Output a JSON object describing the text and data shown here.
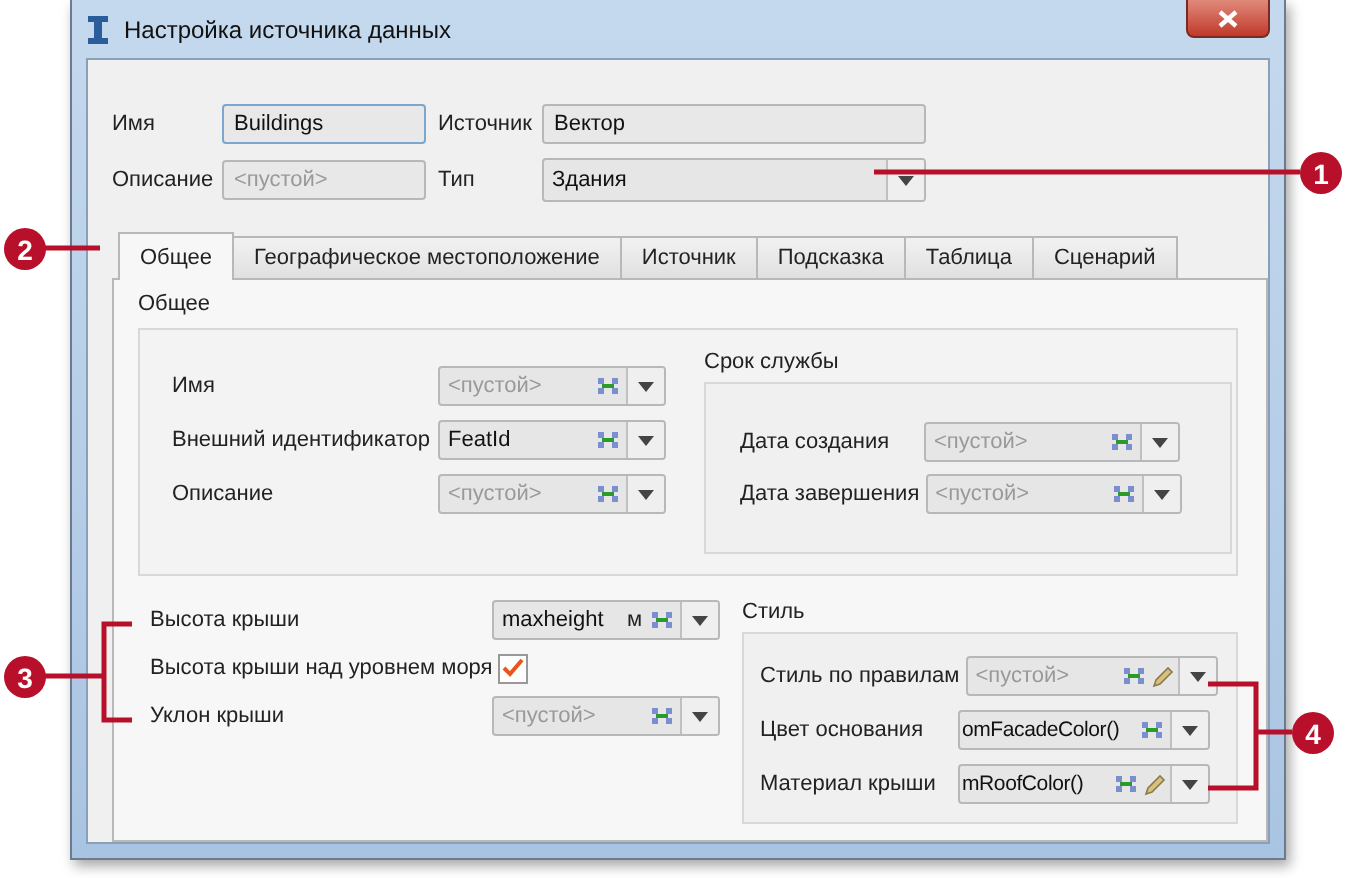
{
  "window": {
    "title": "Настройка источника данных"
  },
  "header": {
    "name": {
      "label": "Имя",
      "value": "Buildings"
    },
    "source": {
      "label": "Источник",
      "value": "Вектор"
    },
    "description": {
      "label": "Описание",
      "placeholder": "<пустой>"
    },
    "type": {
      "label": "Тип",
      "value": "Здания"
    }
  },
  "tabs": [
    {
      "label": "Общее",
      "selected": true
    },
    {
      "label": "Географическое местоположение",
      "selected": false
    },
    {
      "label": "Источник",
      "selected": false
    },
    {
      "label": "Подсказка",
      "selected": false
    },
    {
      "label": "Таблица",
      "selected": false
    },
    {
      "label": "Сценарий",
      "selected": false
    }
  ],
  "general": {
    "title": "Общее",
    "fields": [
      {
        "label": "Имя",
        "placeholder": "<пустой>"
      },
      {
        "label": "Внешний идентификатор",
        "value": "FeatId"
      },
      {
        "label": "Описание",
        "placeholder": "<пустой>"
      }
    ],
    "service_life": {
      "title": "Срок службы",
      "fields": [
        {
          "label": "Дата создания",
          "placeholder": "<пустой>"
        },
        {
          "label": "Дата завершения",
          "placeholder": "<пустой>"
        }
      ]
    }
  },
  "roof": [
    {
      "kind": "combo",
      "label": "Высота крыши",
      "value": "maxheight",
      "unit": "м"
    },
    {
      "kind": "checkbox",
      "label": "Высота крыши над уровнем моря",
      "checked": true
    },
    {
      "kind": "combo",
      "label": "Уклон крыши",
      "placeholder": "<пустой>"
    }
  ],
  "style": {
    "title": "Стиль",
    "fields": [
      {
        "label": "Стиль по правилам",
        "placeholder": "<пустой>",
        "editable": true
      },
      {
        "label": "Цвет основания",
        "value": "omFacadeColor()",
        "editable": false
      },
      {
        "label": "Материал крыши",
        "value": "mRoofColor()",
        "editable": true
      }
    ]
  },
  "callouts": [
    "1",
    "2",
    "3",
    "4"
  ]
}
